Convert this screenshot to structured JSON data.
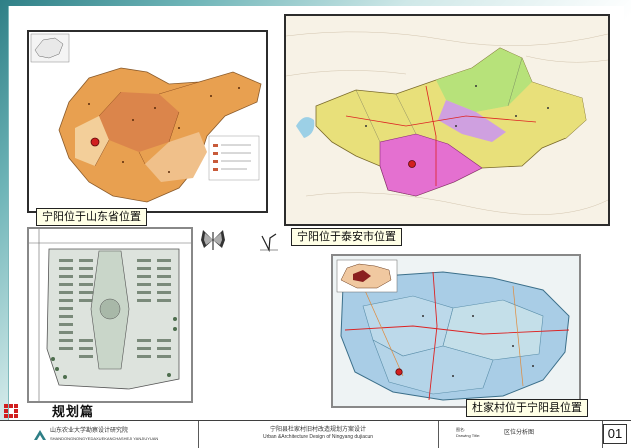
{
  "labels": {
    "shandong": "宁阳位于山东省位置",
    "taian": "宁阳位于泰安市位置",
    "ningyang": "杜家村位于宁阳县位置",
    "plan_caption": "规划篇"
  },
  "footer": {
    "institute_cn": "山东农业大学勘察设计研究院",
    "institute_en": "SHANDONGNONGYEDAXUEKANCHASHEJI YANJIUYUAN",
    "project_cn": "宁阳县杜家村旧村改造规划方案设计",
    "project_en": "Urban &Architecture Design of Ningyang dujiacun",
    "drawing_title_cn": "图名:",
    "drawing_title_en": "Drawing Title:",
    "drawing_name": "区位分析图",
    "sheet_number": "01"
  },
  "colors": {
    "accent_red": "#d11f1f",
    "teal": "#2e7f86",
    "frame_border": "#2c2c2c",
    "shandong_orange": "#e8a050",
    "taian_pink": "#e470d0",
    "taian_yellow": "#e8e07a",
    "taian_green": "#b7e27a",
    "ningyang_blue": "#a9cde6"
  },
  "icons": {
    "plan_logo": "butterfly-icon",
    "corner_mark": "red-grid-icon"
  }
}
